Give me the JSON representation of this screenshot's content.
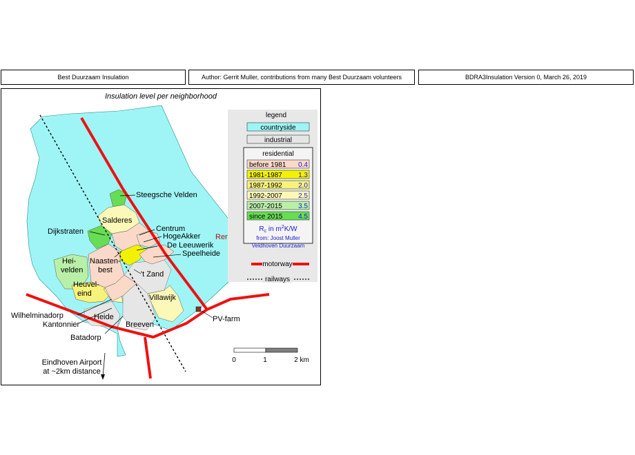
{
  "header": {
    "left": "Best Duurzaam Insulation",
    "center": "Author: Gerrit Muller, contributions from many Best Duurzaam volunteers",
    "right": "BDRA3Insulation Version 0, March 26, 2019"
  },
  "map": {
    "title": "Insulation level per neighborhood",
    "legend": {
      "title": "legend",
      "countryside": "countryside",
      "industrial": "industrial",
      "residential_title": "residential",
      "residential_items": [
        {
          "label": "before 1981",
          "value": "0.4",
          "color": "#fbd9c8"
        },
        {
          "label": "1981-1987",
          "value": "1.3",
          "color": "#f2f200"
        },
        {
          "label": "1987-1992",
          "value": "2.0",
          "color": "#f7f37a"
        },
        {
          "label": "1992-2007",
          "value": "2.5",
          "color": "#fbf8b8"
        },
        {
          "label": "2007-2015",
          "value": "3.5",
          "color": "#b9f0a8"
        },
        {
          "label": "since 2015",
          "value": "4.5",
          "color": "#66dd55"
        }
      ],
      "unit_prefix": "R",
      "unit_sub": "c",
      "unit_middle": " in m",
      "unit_sup": "2",
      "unit_suffix": "K/W",
      "source_line1": "from: Joost Muller",
      "source_line2": "Veldhoven Duurzaam",
      "motorway": "motorway",
      "railways": "railways"
    },
    "labels": {
      "steegsche_velden": "Steegsche Velden",
      "salderes": "Salderes",
      "dijkstraten": "Dijkstraten",
      "centrum": "Centrum",
      "hogeakker": "HogeAkker",
      "de_leeuwerik": "De Leeuwerik",
      "speelheide": "Speelheide",
      "heivelden_1": "Hei-",
      "heivelden_2": "velden",
      "naastenbest_1": "Naasten-",
      "naastenbest_2": "best",
      "t_zand": "'t Zand",
      "heuveleind_1": "Heuvel-",
      "heuveleind_2": "eind",
      "villawijk": "Villawijk",
      "wilhelminadorp": "Wilhelminadorp",
      "kantonnier": "Kantonnier",
      "heide": "Heide",
      "breeven": "Breeven",
      "batadorp": "Batadorp",
      "pv_farm": "PV-farm",
      "rendac": "Rendac",
      "airport_1": "Eindhoven Airport",
      "airport_2": "at ~2km distance"
    },
    "scale": {
      "zero": "0",
      "one": "1",
      "two": "2 km"
    },
    "colors": {
      "countryside": "#9ff5f5",
      "industrial": "#e6e6e6",
      "motorway": "#ee1111",
      "rendac": "#aa1111",
      "legend_text_blue": "#1a1acc"
    }
  }
}
